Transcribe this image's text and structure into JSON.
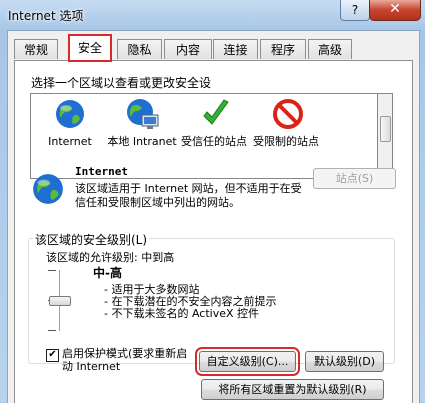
{
  "window": {
    "title": "Internet 选项",
    "help": "?",
    "close": "✕"
  },
  "tabs": [
    {
      "label": "常规"
    },
    {
      "label": "安全"
    },
    {
      "label": "隐私"
    },
    {
      "label": "内容"
    },
    {
      "label": "连接"
    },
    {
      "label": "程序"
    },
    {
      "label": "高级"
    }
  ],
  "security": {
    "select_zone_prompt": "选择一个区域以查看或更改安全设",
    "zones": [
      {
        "label": "Internet",
        "icon": "globe-icon"
      },
      {
        "label": "本地 Intranet",
        "icon": "intranet-icon"
      },
      {
        "label": "受信任的站点",
        "icon": "checkmark-icon"
      },
      {
        "label": "受限制的站点",
        "icon": "no-entry-icon"
      }
    ],
    "selected_zone_title": "Internet",
    "selected_zone_desc": "该区域适用于 Internet 网站，但不适用于在受信任和受限制区域中列出的网站。",
    "sites_button": "站点(S)",
    "level_group_label": "该区域的安全级别(L)",
    "allowed_levels": "该区域的允许级别: 中到高",
    "level_name": "中-高",
    "level_points": [
      "- 适用于大多数网站",
      "- 在下载潜在的不安全内容之前提示",
      "- 不下载未签名的 ActiveX 控件"
    ],
    "protected_mode_label": "启用保护模式(要求重新启动 Internet",
    "custom_level_button": "自定义级别(C)...",
    "default_level_button": "默认级别(D)",
    "reset_all_button": "将所有区域重置为默认级别(R)"
  }
}
